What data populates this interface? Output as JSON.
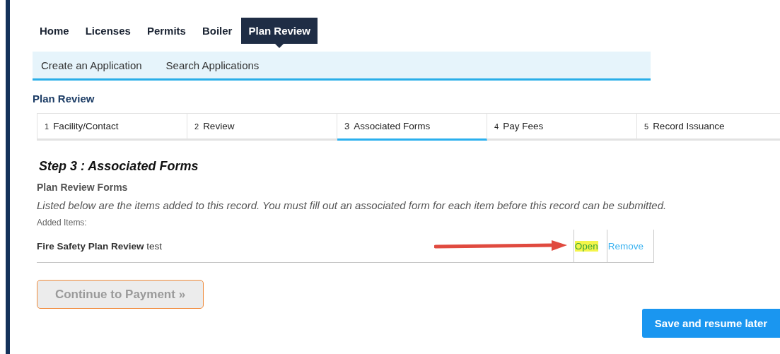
{
  "nav": {
    "tabs": [
      {
        "label": "Home",
        "selected": false
      },
      {
        "label": "Licenses",
        "selected": false
      },
      {
        "label": "Permits",
        "selected": false
      },
      {
        "label": "Boiler",
        "selected": false
      },
      {
        "label": "Plan Review",
        "selected": true
      }
    ]
  },
  "subnav": {
    "links": [
      "Create an Application",
      "Search Applications"
    ]
  },
  "page_title": "Plan Review",
  "steps": [
    {
      "number": "1",
      "label": "Facility/Contact",
      "selected": false
    },
    {
      "number": "2",
      "label": "Review",
      "selected": false
    },
    {
      "number": "3",
      "label": "Associated Forms",
      "selected": true
    },
    {
      "number": "4",
      "label": "Pay Fees",
      "selected": false
    },
    {
      "number": "5",
      "label": "Record Issuance",
      "selected": false
    }
  ],
  "step_heading": "Step 3 : Associated Forms",
  "section_title": "Plan Review Forms",
  "instructions": "Listed below are the items added to this record. You must fill out an associated form for each item before this record can be submitted.",
  "added_items_label": "Added Items:",
  "items": [
    {
      "name": "**Fire Safety Plan Review** test",
      "annotated": true,
      "actions": [
        {
          "label": "Open",
          "highlighted": true
        },
        {
          "label": "Remove",
          "highlighted": false
        }
      ]
    }
  ],
  "continue_button": {
    "label": "Continue to Payment »",
    "disabled": true
  },
  "save_button": {
    "label": "Save and resume later"
  }
}
